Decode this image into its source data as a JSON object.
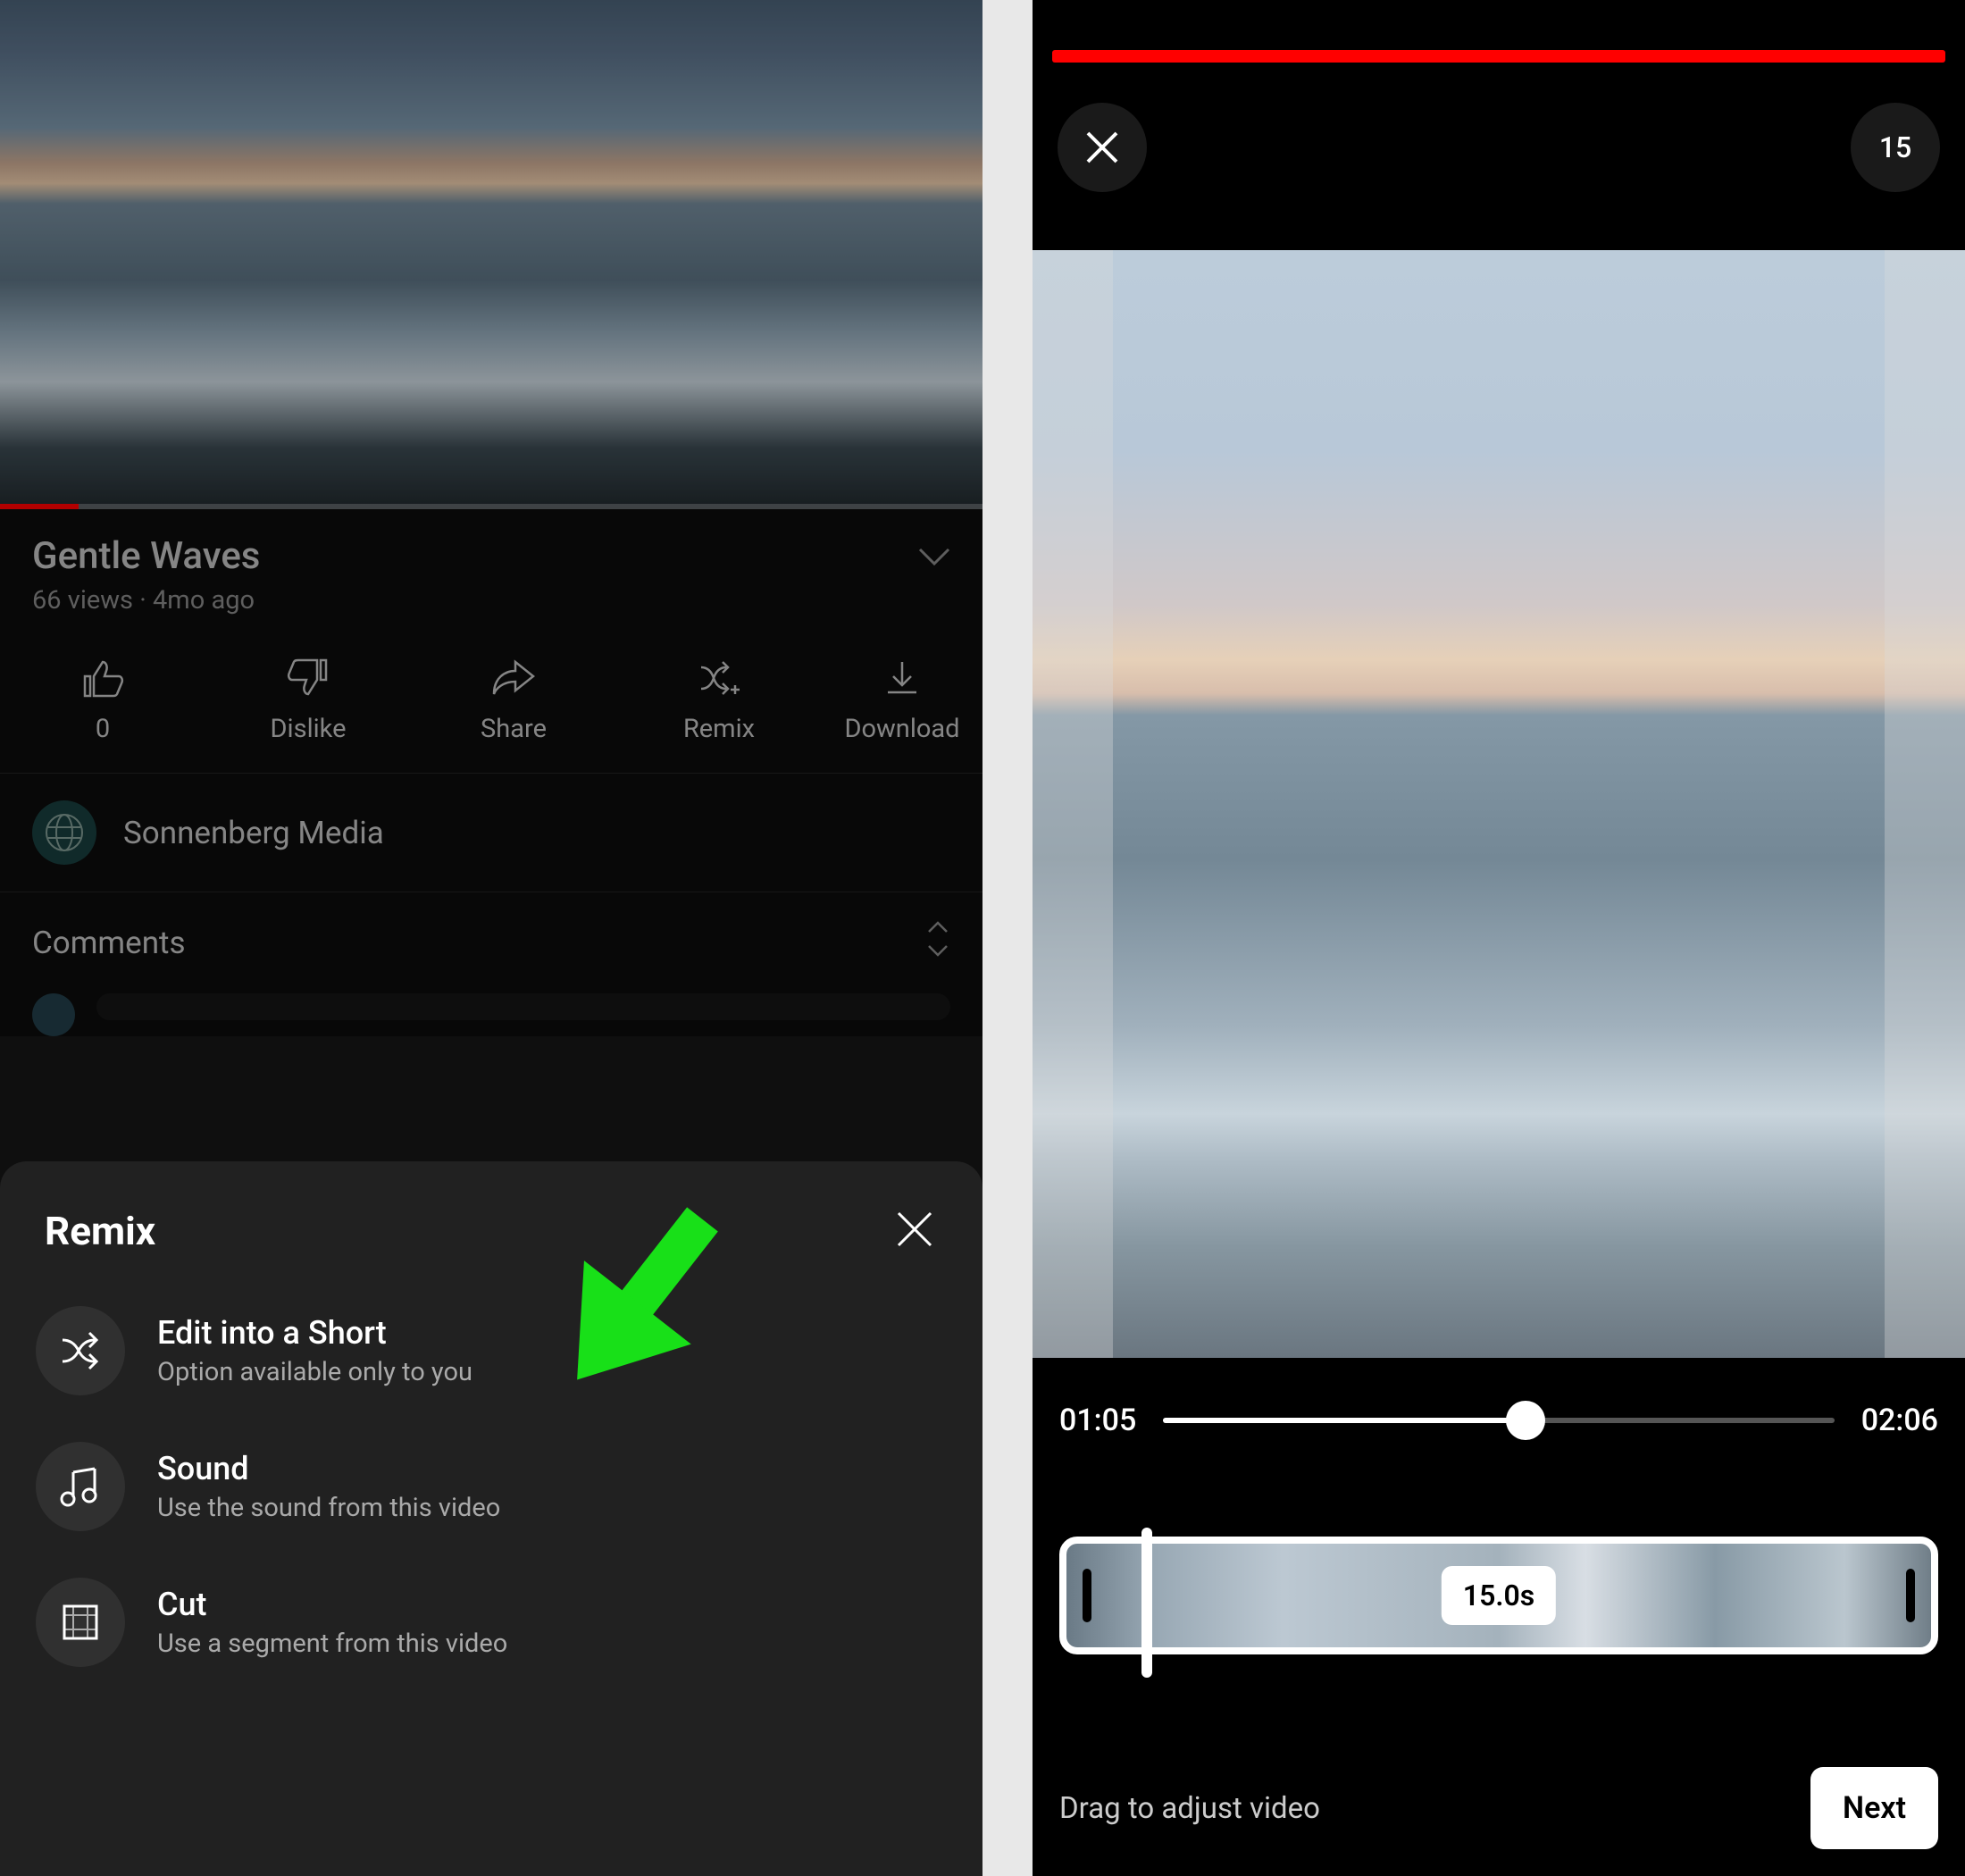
{
  "left": {
    "video": {
      "title": "Gentle Waves",
      "meta": "66 views · 4mo ago"
    },
    "actions": {
      "like": "0",
      "dislike": "Dislike",
      "share": "Share",
      "remix": "Remix",
      "download": "Download"
    },
    "channel": {
      "name": "Sonnenberg Media"
    },
    "comments": {
      "label": "Comments"
    },
    "remix_panel": {
      "title": "Remix",
      "options": {
        "edit": {
          "title": "Edit into a Short",
          "sub": "Option available only to you"
        },
        "sound": {
          "title": "Sound",
          "sub": "Use the sound from this video"
        },
        "cut": {
          "title": "Cut",
          "sub": "Use a segment from this video"
        }
      }
    }
  },
  "right": {
    "duration_limit": "15",
    "time_current": "01:05",
    "time_total": "02:06",
    "clip_duration": "15.0s",
    "drag_hint": "Drag to adjust video",
    "next": "Next"
  }
}
